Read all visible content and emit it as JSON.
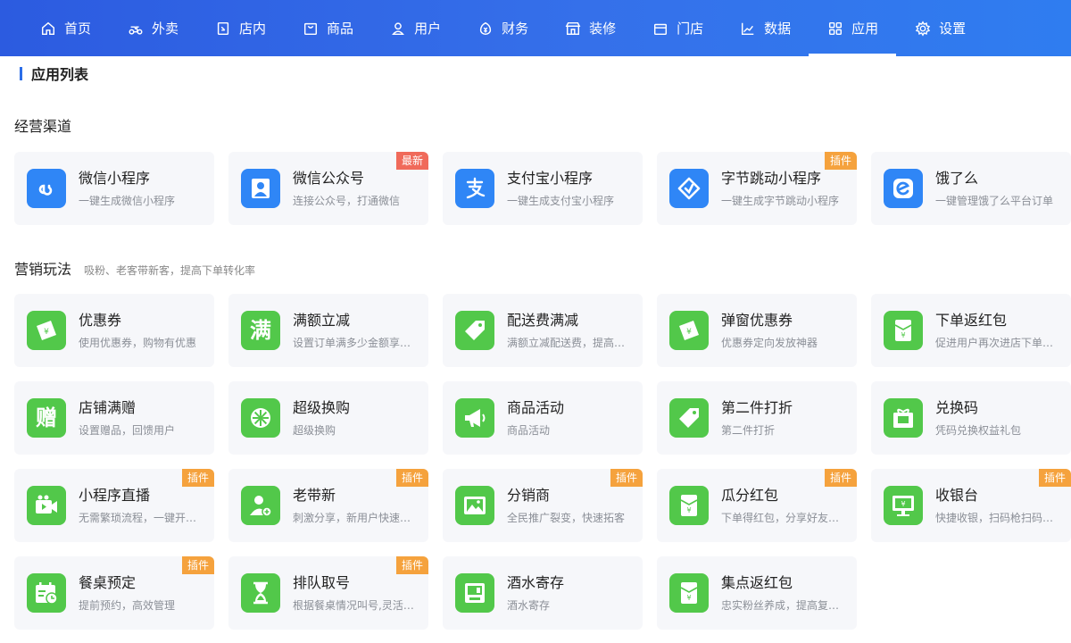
{
  "nav": [
    {
      "label": "首页",
      "icon": "home-icon"
    },
    {
      "label": "外卖",
      "icon": "scooter-icon"
    },
    {
      "label": "店内",
      "icon": "store-icon"
    },
    {
      "label": "商品",
      "icon": "bag-icon"
    },
    {
      "label": "用户",
      "icon": "user-icon"
    },
    {
      "label": "财务",
      "icon": "money-icon"
    },
    {
      "label": "装修",
      "icon": "shop-front-icon"
    },
    {
      "label": "门店",
      "icon": "shop-icon"
    },
    {
      "label": "数据",
      "icon": "chart-icon"
    },
    {
      "label": "应用",
      "icon": "apps-icon",
      "active": true
    },
    {
      "label": "设置",
      "icon": "gear-icon"
    }
  ],
  "page_title": "应用列表",
  "sections": [
    {
      "name": "经营渠道",
      "subtitle": "",
      "apps": [
        {
          "title": "微信小程序",
          "desc": "一键生成微信小程序",
          "icon": "miniprogram-icon",
          "color": "#2f86f6",
          "badge": ""
        },
        {
          "title": "微信公众号",
          "desc": "连接公众号，打通微信",
          "icon": "official-account-icon",
          "color": "#2f86f6",
          "badge": "最新"
        },
        {
          "title": "支付宝小程序",
          "desc": "一键生成支付宝小程序",
          "icon": "alipay-icon",
          "color": "#2f86f6",
          "badge": ""
        },
        {
          "title": "字节跳动小程序",
          "desc": "一键生成字节跳动小程序",
          "icon": "bytedance-icon",
          "color": "#2f86f6",
          "badge": "插件"
        },
        {
          "title": "饿了么",
          "desc": "一键管理饿了么平台订单",
          "icon": "eleme-icon",
          "color": "#2f86f6",
          "badge": ""
        }
      ]
    },
    {
      "name": "营销玩法",
      "subtitle": "吸粉、老客带新客，提高下单转化率",
      "apps": [
        {
          "title": "优惠券",
          "desc": "使用优惠券，购物有优惠",
          "icon": "coupon-icon",
          "color": "#52c84a",
          "badge": ""
        },
        {
          "title": "满额立减",
          "desc": "设置订单满多少金额享受立减",
          "icon": "full-reduction-icon",
          "char": "满",
          "color": "#52c84a",
          "badge": ""
        },
        {
          "title": "配送费满减",
          "desc": "满额立减配送费，提高客单价",
          "icon": "price-tag-icon",
          "color": "#52c84a",
          "badge": ""
        },
        {
          "title": "弹窗优惠券",
          "desc": "优惠券定向发放神器",
          "icon": "popup-coupon-icon",
          "color": "#52c84a",
          "badge": ""
        },
        {
          "title": "下单返红包",
          "desc": "促进用户再次进店下单消费",
          "icon": "red-packet-icon",
          "color": "#52c84a",
          "badge": ""
        },
        {
          "title": "店铺满赠",
          "desc": "设置赠品，回馈用户",
          "icon": "gift-char-icon",
          "char": "赠",
          "color": "#52c84a",
          "badge": ""
        },
        {
          "title": "超级换购",
          "desc": "超级换购",
          "icon": "wheel-icon",
          "color": "#52c84a",
          "badge": ""
        },
        {
          "title": "商品活动",
          "desc": "商品活动",
          "icon": "megaphone-icon",
          "color": "#52c84a",
          "badge": ""
        },
        {
          "title": "第二件打折",
          "desc": "第二件打折",
          "icon": "discount-tag-icon",
          "color": "#52c84a",
          "badge": ""
        },
        {
          "title": "兑换码",
          "desc": "凭码兑换权益礼包",
          "icon": "gift-box-icon",
          "color": "#52c84a",
          "badge": ""
        },
        {
          "title": "小程序直播",
          "desc": "无需繁琐流程，一键开播卖货",
          "icon": "live-video-icon",
          "color": "#52c84a",
          "badge": "插件"
        },
        {
          "title": "老带新",
          "desc": "刺激分享，新用户快速增长",
          "icon": "user-add-icon",
          "color": "#52c84a",
          "badge": "插件"
        },
        {
          "title": "分销商",
          "desc": "全民推广裂变，快速拓客",
          "icon": "picture-icon",
          "color": "#52c84a",
          "badge": "插件"
        },
        {
          "title": "瓜分红包",
          "desc": "下单得红包，分享好友瓜分",
          "icon": "red-packet-icon",
          "color": "#52c84a",
          "badge": "插件"
        },
        {
          "title": "收银台",
          "desc": "快捷收银，扫码枪扫码收款",
          "icon": "cashier-monitor-icon",
          "color": "#52c84a",
          "badge": "插件"
        },
        {
          "title": "餐桌预定",
          "desc": "提前预约，高效管理",
          "icon": "calendar-clock-icon",
          "color": "#52c84a",
          "badge": "插件"
        },
        {
          "title": "排队取号",
          "desc": "根据餐桌情况叫号,灵活安排",
          "icon": "hourglass-icon",
          "color": "#52c84a",
          "badge": "插件"
        },
        {
          "title": "酒水寄存",
          "desc": "酒水寄存",
          "icon": "storage-box-icon",
          "color": "#52c84a",
          "badge": ""
        },
        {
          "title": "集点返红包",
          "desc": "忠实粉丝养成，提高复购率",
          "icon": "red-packet-icon",
          "color": "#52c84a",
          "badge": ""
        }
      ]
    }
  ]
}
